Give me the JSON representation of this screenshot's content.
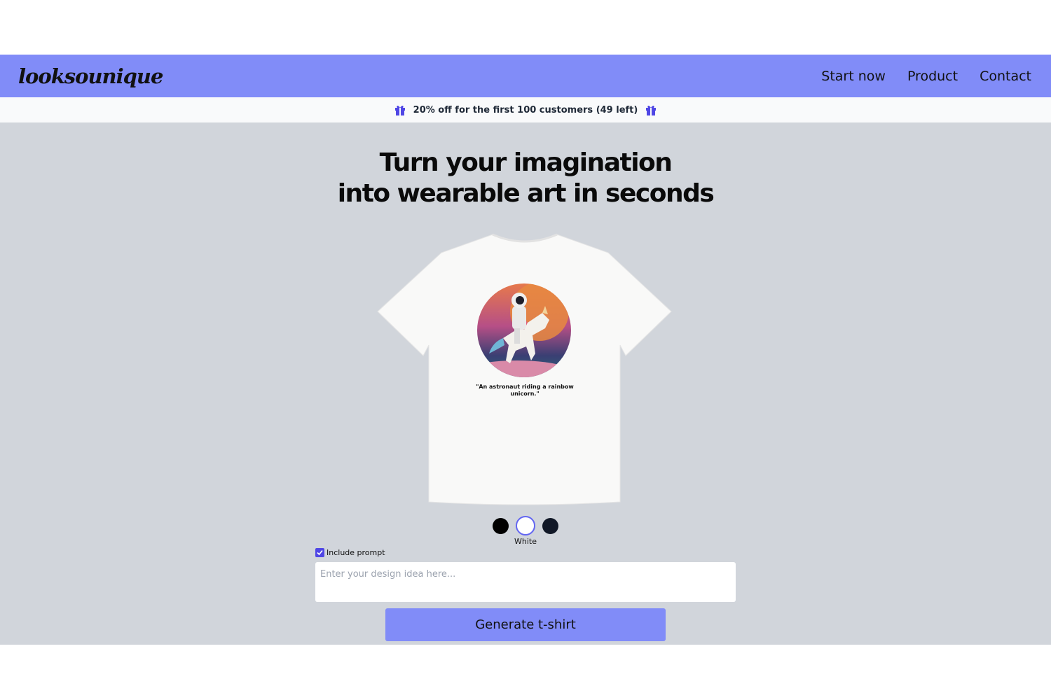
{
  "header": {
    "logo": "looksounique",
    "nav": [
      {
        "label": "Start now"
      },
      {
        "label": "Product"
      },
      {
        "label": "Contact"
      }
    ],
    "bg_color": "#818cf8"
  },
  "promo": {
    "text": "20% off for the first 100 customers (49 left)",
    "icon": "gift-icon"
  },
  "hero": {
    "line1": "Turn your imagination",
    "line2": "into wearable art in seconds"
  },
  "product": {
    "caption_line1": "\"An astronaut riding a rainbow",
    "caption_line2": "unicorn.\"",
    "colors": [
      {
        "name": "Black",
        "hex": "#000000",
        "selected": false
      },
      {
        "name": "White",
        "hex": "#ffffff",
        "selected": true
      },
      {
        "name": "Navy",
        "hex": "#111827",
        "selected": false
      }
    ],
    "selected_color_label": "White"
  },
  "form": {
    "include_prompt_label": "Include prompt",
    "include_prompt_checked": true,
    "input_placeholder": "Enter your design idea here...",
    "input_value": "",
    "generate_label": "Generate t-shirt"
  },
  "colors": {
    "accent": "#818cf8",
    "checkbox": "#4f46e5",
    "main_bg": "#d1d5db"
  }
}
